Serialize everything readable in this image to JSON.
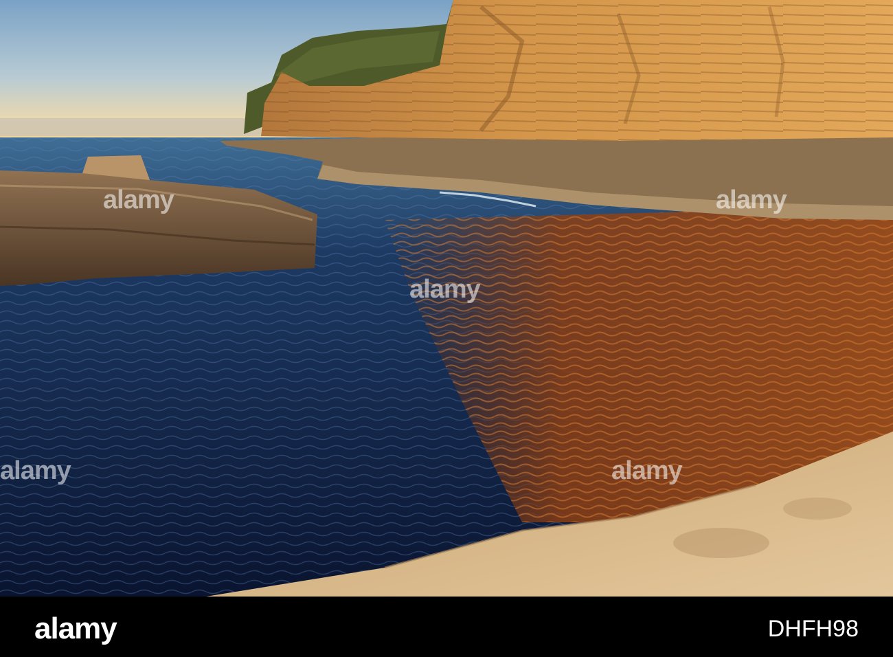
{
  "watermark": {
    "text": "alamy",
    "color": "#ffffff"
  },
  "footer": {
    "brand": "alamy",
    "image_code": "DHFH98"
  },
  "scene": {
    "subject": "sandstone sea cliffs at sunrise with rock shelf and tidal pool",
    "colors": {
      "sky_top": "#7fa7c8",
      "sky_horizon": "#f1d7a5",
      "ocean_dark": "#0b1a38",
      "cliff_lit": "#d99a4a",
      "vegetation": "#4f5a2c",
      "reflection": "#9a4a18",
      "foreground_rock": "#d8b98a"
    }
  }
}
